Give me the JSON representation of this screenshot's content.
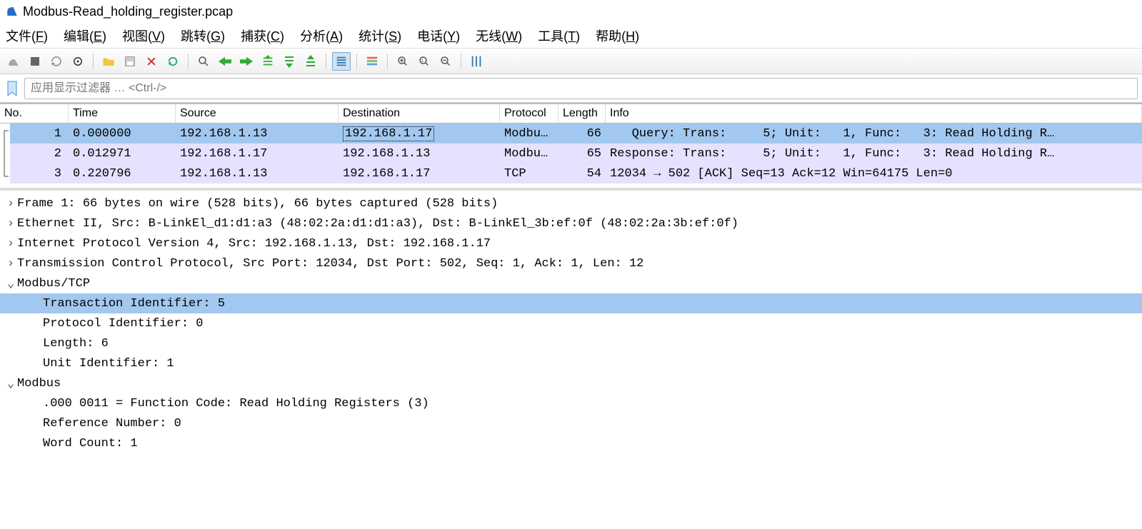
{
  "title": "Modbus-Read_holding_register.pcap",
  "menu": {
    "file": "文件(F)",
    "edit": "编辑(E)",
    "view": "视图(V)",
    "go": "跳转(G)",
    "capture": "捕获(C)",
    "analyze": "分析(A)",
    "stats": "统计(S)",
    "phone": "电话(Y)",
    "wireless": "无线(W)",
    "tools": "工具(T)",
    "help": "帮助(H)"
  },
  "filter": {
    "placeholder": "应用显示过滤器 … <Ctrl-/>"
  },
  "columns": {
    "no": "No.",
    "time": "Time",
    "source": "Source",
    "destination": "Destination",
    "protocol": "Protocol",
    "length": "Length",
    "info": "Info"
  },
  "packets": [
    {
      "no": "1",
      "time": "0.000000",
      "src": "192.168.1.13",
      "dst": "192.168.1.17",
      "proto": "Modbu…",
      "len": "66",
      "info": "   Query: Trans:     5; Unit:   1, Func:   3: Read Holding R…"
    },
    {
      "no": "2",
      "time": "0.012971",
      "src": "192.168.1.17",
      "dst": "192.168.1.13",
      "proto": "Modbu…",
      "len": "65",
      "info": "Response: Trans:     5; Unit:   1, Func:   3: Read Holding R…"
    },
    {
      "no": "3",
      "time": "0.220796",
      "src": "192.168.1.13",
      "dst": "192.168.1.17",
      "proto": "TCP",
      "len": "54",
      "info": "12034 → 502 [ACK] Seq=13 Ack=12 Win=64175 Len=0"
    }
  ],
  "details": {
    "frame": "Frame 1: 66 bytes on wire (528 bits), 66 bytes captured (528 bits)",
    "eth": "Ethernet II, Src: B-LinkEl_d1:d1:a3 (48:02:2a:d1:d1:a3), Dst: B-LinkEl_3b:ef:0f (48:02:2a:3b:ef:0f)",
    "ip": "Internet Protocol Version 4, Src: 192.168.1.13, Dst: 192.168.1.17",
    "tcp": "Transmission Control Protocol, Src Port: 12034, Dst Port: 502, Seq: 1, Ack: 1, Len: 12",
    "mbtcp": "Modbus/TCP",
    "transid": "Transaction Identifier: 5",
    "protoid": "Protocol Identifier: 0",
    "length": "Length: 6",
    "unitid": "Unit Identifier: 1",
    "modbus": "Modbus",
    "funccode": ".000 0011 = Function Code: Read Holding Registers (3)",
    "refnum": "Reference Number: 0",
    "wordcnt": "Word Count: 1"
  }
}
